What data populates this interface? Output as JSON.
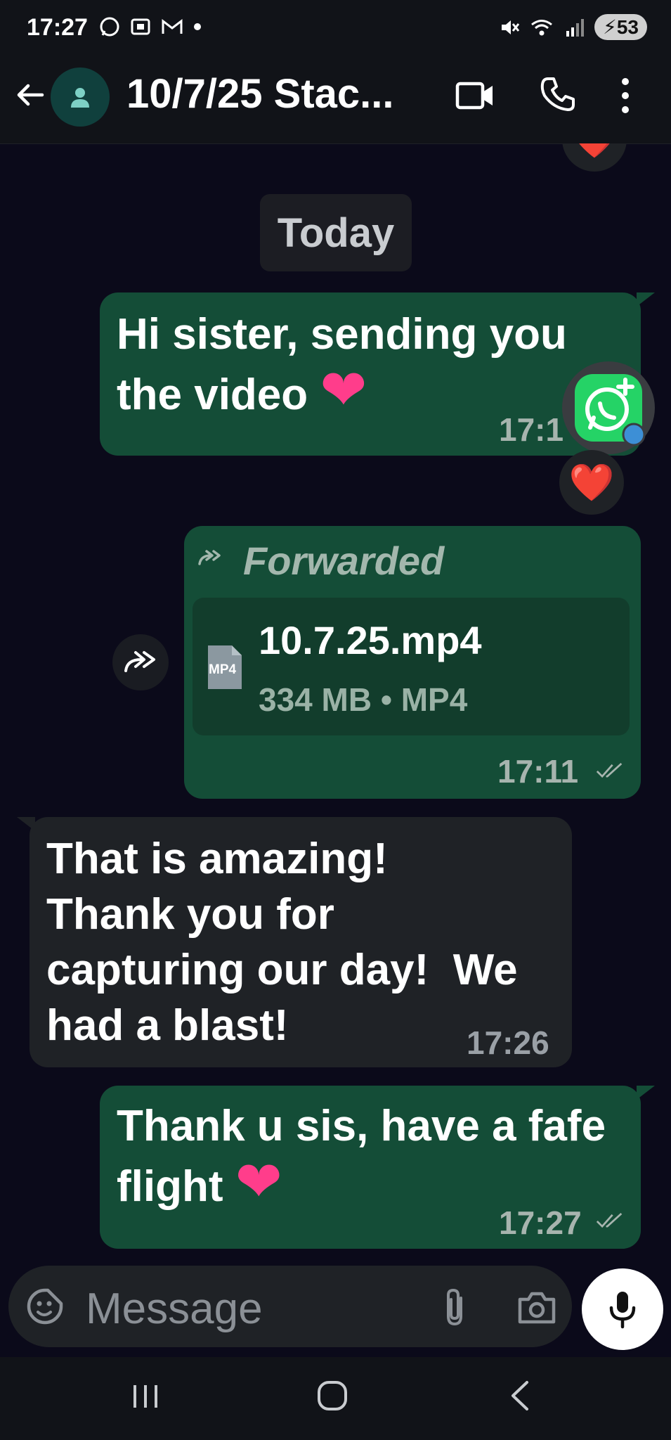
{
  "status_bar": {
    "time": "17:27",
    "left_icons": [
      "whatsapp-icon",
      "screenshot-icon",
      "gmail-icon",
      "dot-icon"
    ],
    "battery": "53"
  },
  "header": {
    "title": "10/7/25 Stac..."
  },
  "date_chip": "Today",
  "messages": [
    {
      "direction": "out",
      "text_line1": "Hi sister, sending you",
      "text_line2": "the video",
      "emoji": "❤",
      "time": "17:1",
      "reaction": "❤️"
    },
    {
      "direction": "out",
      "forwarded_label": "Forwarded",
      "file_name": "10.7.25.mp4",
      "file_meta": "334 MB • MP4",
      "file_type_badge": "MP4",
      "time": "17:11"
    },
    {
      "direction": "in",
      "line1": "That is amazing!",
      "line2": "Thank you for",
      "line3": "capturing our day!  We",
      "line4": "had a blast!",
      "time": "17:26"
    },
    {
      "direction": "out",
      "line1": "Thank u sis, have a fafe",
      "line2": "flight",
      "emoji": "❤",
      "time": "17:27"
    }
  ],
  "composer": {
    "placeholder": "Message"
  },
  "colors": {
    "background": "#0b0a1a",
    "outgoing_bubble": "#144d37",
    "incoming_bubble": "#1f2226",
    "accent_green": "#25d366"
  }
}
